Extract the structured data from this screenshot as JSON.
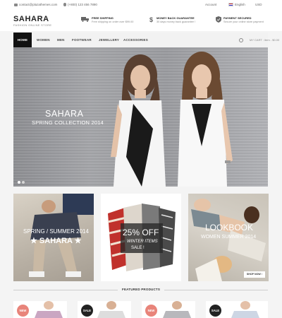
{
  "topbar": {
    "email": "contact@plazathemes.com",
    "phone": "(+800) 123 456 7890",
    "account": "Account",
    "language": "English",
    "currency": "USD"
  },
  "header": {
    "logo": "SAHARA",
    "tagline": "FASHION ONLINE STORE",
    "features": [
      {
        "title": "FREE SHIPPING",
        "subtitle": "Free shipping on order over $99.00",
        "icon": "truck-icon"
      },
      {
        "title": "MONEY BACK GUARANTEE",
        "subtitle": "30 days money back guarantee !",
        "icon": "dollar-icon"
      },
      {
        "title": "PAYMENT SECURED",
        "subtitle": "Secure your online store payment",
        "icon": "shield-check-icon"
      }
    ]
  },
  "nav": {
    "items": [
      "HOME",
      "WOMEN",
      "MEN",
      "FOOTWEAR",
      "JEWELLERY",
      "ACCESSORIES"
    ],
    "active": "HOME",
    "cart": "MY CART : item - $0.00"
  },
  "hero": {
    "title": "SAHARA",
    "subtitle": "SPRING COLLECTION 2014"
  },
  "banners": [
    {
      "line1": "SPRING / SUMMER 2014",
      "line2": "★ SAHARA ★"
    },
    {
      "line1": "25% OFF",
      "line2": "WINTER ITEMS",
      "line3": "SALE !"
    },
    {
      "line1": "LOOKBOOK",
      "line2": "WOMEN SUMMER 2014",
      "button": "SHOP NOW ›"
    }
  ],
  "featured": {
    "title": "FEATURED PRODUCTS",
    "products": [
      {
        "badge": "NEW"
      },
      {
        "badge": "SALE"
      },
      {
        "badge": "NEW"
      },
      {
        "badge": "SALE"
      }
    ]
  },
  "colors": {
    "nav_active": "#111111",
    "badge_new": "#e8847a",
    "badge_sale": "#222222"
  }
}
